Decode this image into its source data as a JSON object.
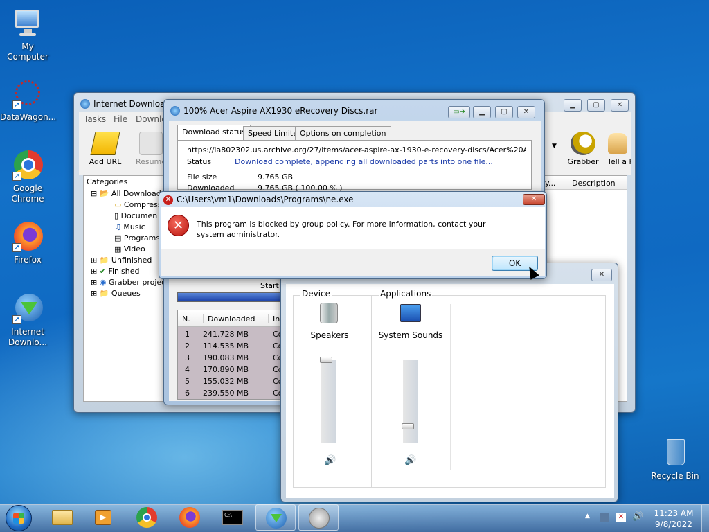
{
  "desktop": {
    "icons": [
      {
        "label": "My Computer"
      },
      {
        "label": "DataWagon..."
      },
      {
        "label": "Google Chrome"
      },
      {
        "label": "Firefox"
      },
      {
        "label": "Internet Downlo..."
      },
      {
        "label": "Recycle Bin"
      }
    ]
  },
  "idm": {
    "title": "Internet Download",
    "menu": [
      "Tasks",
      "File",
      "Downlo"
    ],
    "toolbar": {
      "add_url": "Add URL",
      "resume": "Resume",
      "grabber": "Grabber",
      "tell": "Tell a Fri"
    },
    "categories_label": "Categories",
    "tree": [
      "All Downloads",
      "Compress",
      "Documen",
      "Music",
      "Programs",
      "Video",
      "Unfinished",
      "Finished",
      "Grabber project",
      "Queues"
    ],
    "columns": {
      "desc": "Description",
      "partial": "y..."
    }
  },
  "dl": {
    "title": "100% Acer Aspire AX1930 eRecovery Discs.rar",
    "tabs": [
      "Download status",
      "Speed Limiter",
      "Options on completion"
    ],
    "url": "https://ia802302.us.archive.org/27/items/acer-aspire-ax-1930-e-recovery-discs/Acer%20Aspire%2",
    "status_label": "Status",
    "status": "Download complete, appending all downloaded parts into one file...",
    "filesize_label": "File size",
    "filesize": "9.765  GB",
    "downloaded_label": "Downloaded",
    "downloaded": "9.765  GB  ( 100.00 % )",
    "start_label": "Start p",
    "table": {
      "headers": [
        "N.",
        "Downloaded",
        "Inf"
      ],
      "rows": [
        [
          "1",
          "241.728  MB",
          "Co"
        ],
        [
          "2",
          "114.535  MB",
          "Co"
        ],
        [
          "3",
          "190.083  MB",
          "Co"
        ],
        [
          "4",
          "170.890  MB",
          "Co"
        ],
        [
          "5",
          "155.032  MB",
          "Co"
        ],
        [
          "6",
          "239.550  MB",
          "Co"
        ]
      ]
    }
  },
  "error": {
    "title": "C:\\Users\\vm1\\Downloads\\Programs\\ne.exe",
    "message": "This program is blocked by group policy. For more information, contact your system administrator.",
    "ok": "OK"
  },
  "mixer": {
    "device": "Device",
    "applications": "Applications",
    "speakers": "Speakers",
    "system_sounds": "System Sounds"
  },
  "taskbar": {
    "time": "11:23 AM",
    "date": "9/8/2022"
  }
}
